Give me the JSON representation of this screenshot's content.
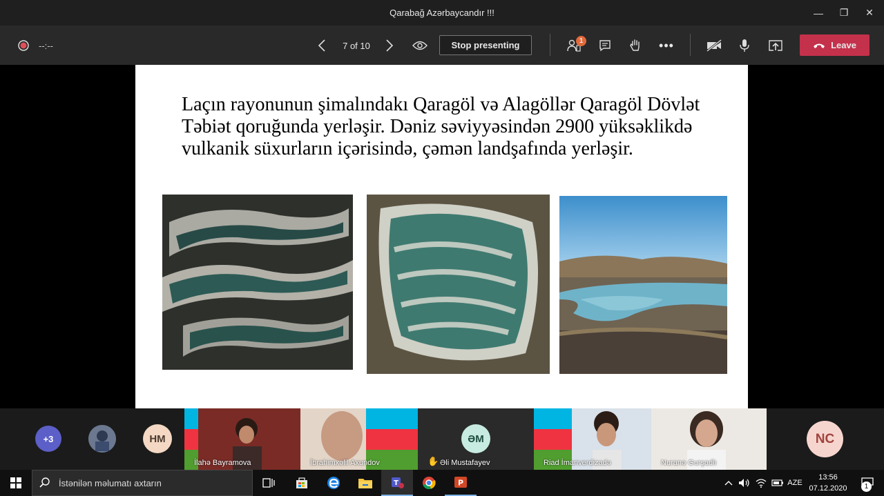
{
  "window": {
    "title": "Qarabağ Azərbaycandır !!!",
    "minimize": "—",
    "maximize": "❐",
    "close": "✕"
  },
  "toolbar": {
    "recording_time": "--:--",
    "page_indicator": "7 of 10",
    "stop_presenting_label": "Stop presenting",
    "participants_badge": "1",
    "leave_label": "Leave",
    "accent_color": "#c4314b"
  },
  "slide": {
    "text": "Laçın rayonunun şimalındakı Qaragöl və Alagöllər Qaragöl Dövlət Təbiət qoruğunda yerləşir. Dəniz səviyyəsindən 2900 yüksəklikdə vulkanik süxurların içərisində, çəmən landşafında yerləşir."
  },
  "gallery": {
    "overflow_count": "+3",
    "tiles": [
      {
        "initials": "HM"
      },
      {
        "name": "İlahə Bayramova"
      },
      {
        "name": "İbrahimxəlil Axundov"
      },
      {
        "initials": "ƏM",
        "name": "Əli Mustafayev"
      },
      {
        "name": "Riad İmanverdizadə"
      },
      {
        "name": "Nuranə Gurşadlı"
      },
      {
        "initials": "NC"
      }
    ]
  },
  "taskbar": {
    "search_placeholder": "İstənilən məlumatı axtarın",
    "language": "AZE",
    "time": "13:56",
    "date": "07.12.2020",
    "notification_count": "1"
  }
}
